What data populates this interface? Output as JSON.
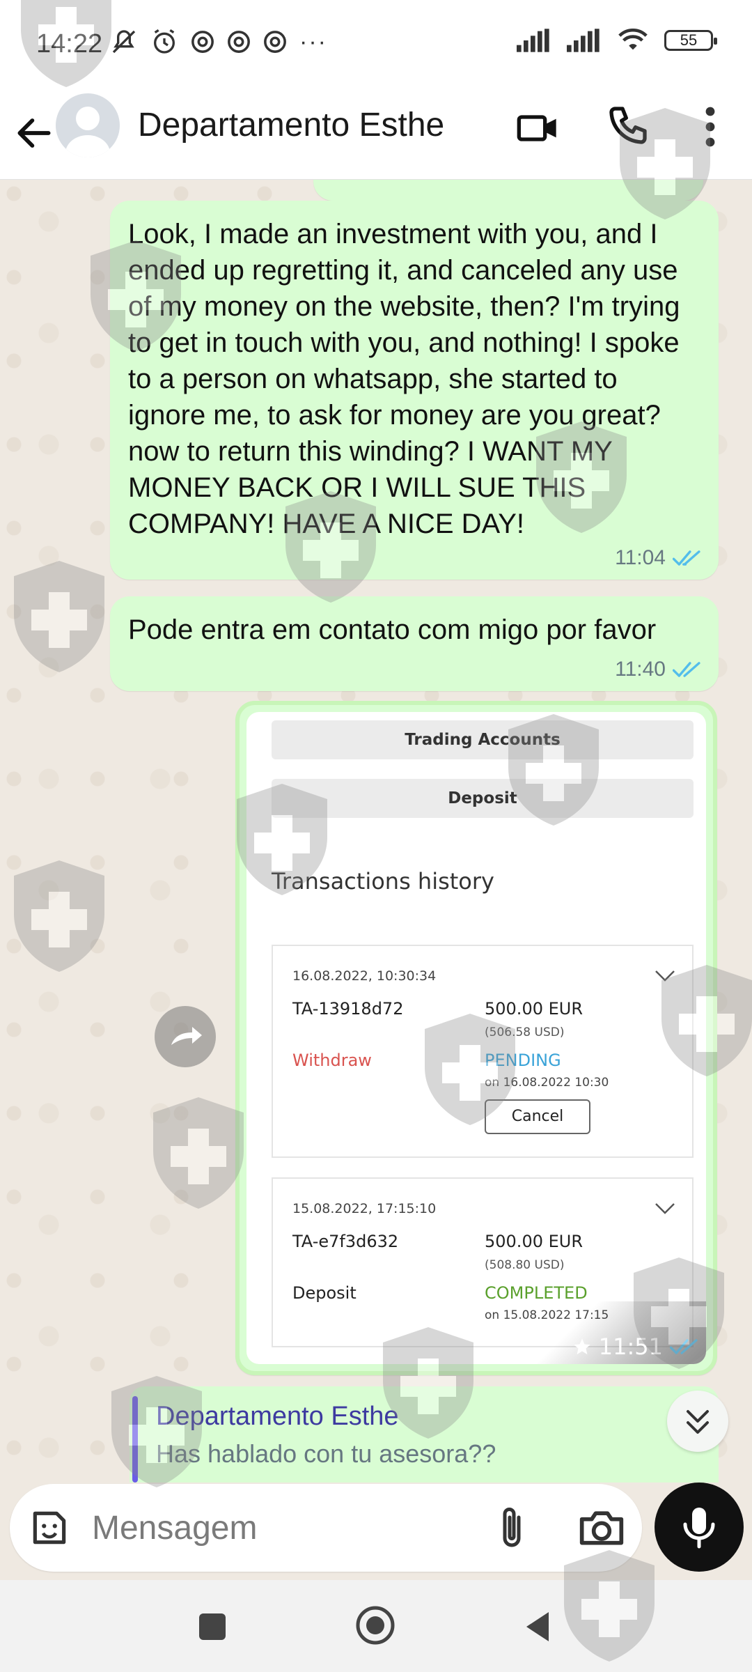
{
  "status_bar": {
    "time": "14:22",
    "battery": "55",
    "overflow": "···",
    "icons": [
      "mute-icon",
      "alarm-icon",
      "chrome-icon",
      "chrome-icon",
      "chrome-icon",
      "signal-icon",
      "signal-icon",
      "wifi-icon",
      "battery-icon"
    ]
  },
  "header": {
    "contact_name": "Departamento Esthe",
    "actions": [
      "back-arrow-icon",
      "video-call-icon",
      "voice-call-icon",
      "more-vert-icon"
    ]
  },
  "messages": [
    {
      "text": "Look, I made an investment with you, and I ended up regretting it, and canceled any use of my money on the website, then? I'm trying to get in touch with you, and nothing! I spoke to a person on whatsapp, she started to ignore me, to ask for money are you great? now to return this winding? I WANT MY MONEY BACK OR I WILL SUE THIS COMPANY! HAVE A NICE DAY!",
      "time": "11:04",
      "status": "read"
    },
    {
      "text": "Pode entra em contato com migo por favor",
      "time": "11:40",
      "status": "read"
    }
  ],
  "image_message": {
    "time": "11:51",
    "starred": true,
    "status": "read",
    "screenshot": {
      "buttons": [
        "Trading Accounts",
        "Deposit"
      ],
      "section_title": "Transactions history",
      "transactions": [
        {
          "datetime": "16.08.2022, 10:30:34",
          "id": "TA-13918d72",
          "amount": "500.00 EUR",
          "usd": "(506.58 USD)",
          "type": "Withdraw",
          "status": "PENDING",
          "status_date": "on 16.08.2022 10:30",
          "action": "Cancel"
        },
        {
          "datetime": "15.08.2022, 17:15:10",
          "id": "TA-e7f3d632",
          "amount": "500.00 EUR",
          "usd": "(508.80 USD)",
          "type": "Deposit",
          "status": "COMPLETED",
          "status_date": "on 15.08.2022 17:15"
        }
      ]
    }
  },
  "reply_preview": {
    "name": "Departamento Esthe",
    "text": "Has hablado con tu asesora??"
  },
  "composer": {
    "placeholder": "Mensagem"
  },
  "colors": {
    "outgoing_bubble": "#d9fdd3",
    "read_ticks": "#53bdeb",
    "withdraw": "#d9534f",
    "pending": "#3aa3d8",
    "completed": "#5aa02c",
    "reply_name": "#3d3aa0"
  }
}
